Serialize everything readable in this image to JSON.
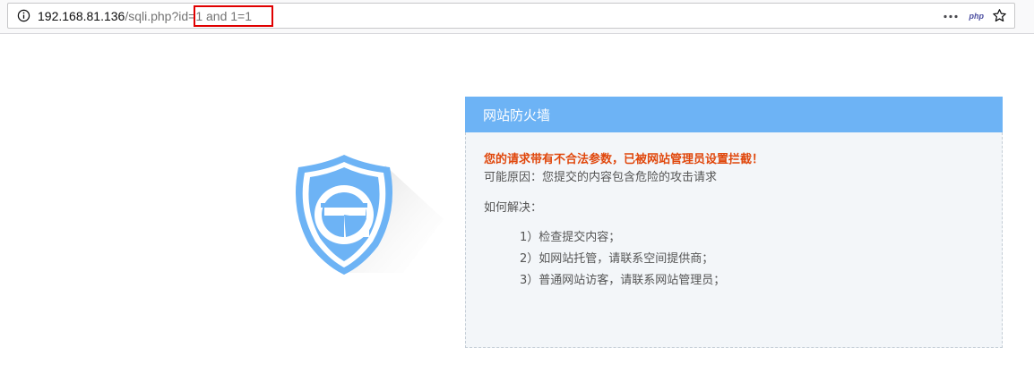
{
  "browser": {
    "url_host": "192.168.81.136",
    "url_path": "/sqli.php?id=",
    "url_param": "1 and 1=1",
    "php_icon_label": "php",
    "icons": [
      "info-icon",
      "more-dots-icon",
      "php-extension-icon",
      "bookmark-star-icon"
    ]
  },
  "waf": {
    "title": "网站防火墙",
    "warning": "您的请求带有不合法参数，已被网站管理员设置拦截！",
    "reason": "可能原因：您提交的内容包含危险的攻击请求",
    "how_title": "如何解决：",
    "steps": [
      "1）检查提交内容；",
      "2）如网站托管，请联系空间提供商；",
      "3）普通网站访客，请联系网站管理员；"
    ]
  },
  "colors": {
    "header_blue": "#6db3f5",
    "warning_orange": "#e0470c",
    "shield_blue": "#6db3f5",
    "highlight_red": "#e00000"
  }
}
